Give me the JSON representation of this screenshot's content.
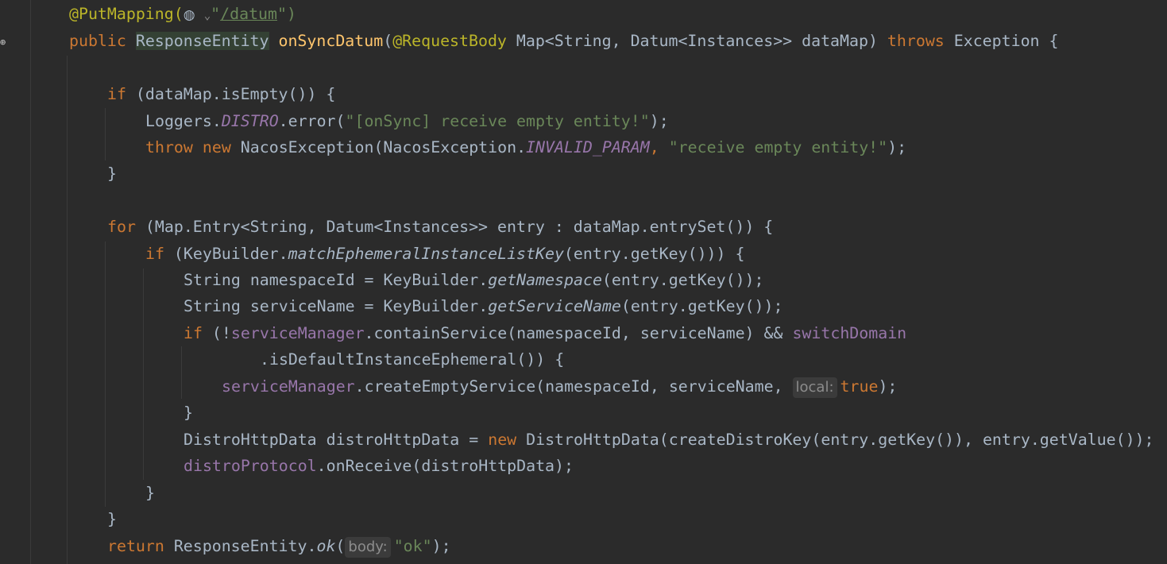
{
  "editor": {
    "tokens": {
      "at_put_mapping": "@PutMapping",
      "put_mapping_open": "(",
      "globe_chevron": "⌄",
      "quote": "\"",
      "put_path": "/datum",
      "put_mapping_close": "\")",
      "public": "public",
      "response_entity_type": "ResponseEntity",
      "on_sync_datum": "onSyncDatum",
      "request_body": "@RequestBody",
      "sig_params": " Map<String, Datum<Instances>> dataMap) ",
      "throws": "throws",
      "sig_end": " Exception {",
      "if": "if",
      "new": "new",
      "for": "for",
      "throw": "throw",
      "return": "return",
      "true": "true",
      "datamap_isempty": " (dataMap.isEmpty()) {",
      "loggers": "Loggers.",
      "distro": "DISTRO",
      "error_call": ".error(",
      "empty_msg_onsync": "\"[onSync] receive empty entity!\"",
      "semicolon_close": ");",
      "nacos_exception_call": " NacosException(NacosException.",
      "invalid_param": "INVALID_PARAM",
      "comma": ", ",
      "empty_msg": "\"receive empty entity!\"",
      "close_brace": "}",
      "for_header": " (Map.Entry<String, Datum<Instances>> entry : dataMap.entrySet()) {",
      "if_keybuilder_open": " (KeyBuilder.",
      "match_key": "matchEphemeralInstanceListKey",
      "entry_getkey_close": "(entry.getKey())) {",
      "ns_decl": "String namespaceId = KeyBuilder.",
      "get_namespace": "getNamespace",
      "entry_getkey_call": "(entry.getKey());",
      "svc_decl": "String serviceName = KeyBuilder.",
      "get_service_name": "getServiceName",
      "if_not": " (!",
      "service_manager": "serviceManager",
      "contain_service": ".containService(namespaceId, serviceName) && ",
      "switch_domain": "switchDomain",
      "is_default_ephemeral": ".isDefaultInstanceEphemeral()) {",
      "create_empty_service": ".createEmptyService(namespaceId, serviceName, ",
      "hint_local": "local:",
      "distro_decl": "DistroHttpData distroHttpData = ",
      "distro_ctor": " DistroHttpData(createDistroKey(entry.getKey()), entry.getValue());",
      "distro_protocol": "distroProtocol",
      "on_receive": ".onReceive(distroHttpData);",
      "response_entity": " ResponseEntity.",
      "ok": "ok",
      "paren_open": "(",
      "hint_body": "body:",
      "ok_str": "\"ok\""
    }
  }
}
